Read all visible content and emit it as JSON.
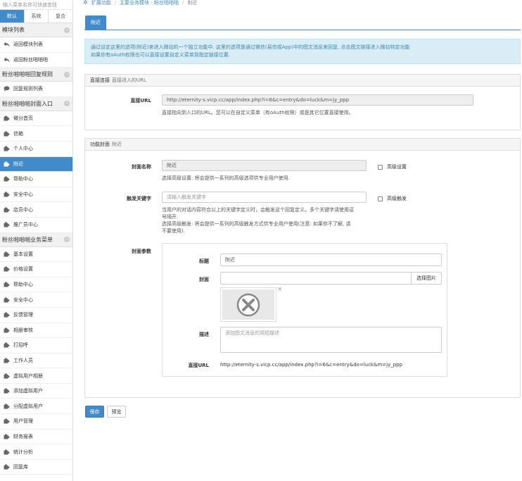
{
  "sidebar": {
    "search_placeholder": "输入菜单名称可快速查找",
    "tabs": [
      "默认",
      "系统",
      "复合"
    ],
    "sections": [
      {
        "title": "模块列表",
        "items": [
          {
            "label": "返回模块列表",
            "icon": "reply-icon"
          },
          {
            "label": "返回粉丝啪啪啪",
            "icon": "reply-icon"
          }
        ]
      },
      {
        "title": "粉丝啪啪啪回复规则",
        "items": [
          {
            "label": "回复规则列表",
            "icon": "comment-icon"
          }
        ]
      },
      {
        "title": "粉丝啪啪啪封面入口",
        "items": [
          {
            "label": "微分首页",
            "icon": "puzzle-icon"
          },
          {
            "label": "信箱",
            "icon": "puzzle-icon"
          },
          {
            "label": "个人中心",
            "icon": "puzzle-icon"
          },
          {
            "label": "附近",
            "icon": "puzzle-icon",
            "active": true
          },
          {
            "label": "帮助中心",
            "icon": "puzzle-icon"
          },
          {
            "label": "安全中心",
            "icon": "puzzle-icon"
          },
          {
            "label": "店员中心",
            "icon": "puzzle-icon"
          },
          {
            "label": "推广员中心",
            "icon": "puzzle-icon"
          }
        ]
      },
      {
        "title": "粉丝啪啪啪业务菜单",
        "items": [
          {
            "label": "基本设置",
            "icon": "puzzle-icon"
          },
          {
            "label": "价格设置",
            "icon": "puzzle-icon"
          },
          {
            "label": "帮助中心",
            "icon": "puzzle-icon"
          },
          {
            "label": "安全中心",
            "icon": "puzzle-icon"
          },
          {
            "label": "反馈管理",
            "icon": "puzzle-icon"
          },
          {
            "label": "相册审核",
            "icon": "puzzle-icon"
          },
          {
            "label": "打招呼",
            "icon": "puzzle-icon"
          },
          {
            "label": "工作人员",
            "icon": "puzzle-icon"
          },
          {
            "label": "虚拟用户相册",
            "icon": "puzzle-icon"
          },
          {
            "label": "添加虚拟用户",
            "icon": "puzzle-icon"
          },
          {
            "label": "分配虚拟用户",
            "icon": "puzzle-icon"
          },
          {
            "label": "用户管理",
            "icon": "puzzle-icon"
          },
          {
            "label": "财务报表",
            "icon": "puzzle-icon"
          },
          {
            "label": "统计分析",
            "icon": "puzzle-icon"
          },
          {
            "label": "回复库",
            "icon": "puzzle-icon"
          }
        ]
      }
    ]
  },
  "breadcrumb": [
    "扩展功能",
    "主要业务模块 - 粉丝啪啪啪",
    "附近"
  ],
  "page_tab": "附近",
  "info": {
    "line1": "通过设定这里的选项(附近)来进入微站的一个独立功能中. 这里的选项是通过微信(易信或App)中的图文消息来回复, 点击图文链接进入微站特定功能",
    "line2": "如果你有oAuth权限也可以直接设置自定义菜单到指定链接位置."
  },
  "direct": {
    "title": "直接连接",
    "subtitle": "直接进入的URL",
    "label": "直接URL",
    "value": "http://eternity-s.vicp.cc/app/index.php?i=6&c=entry&do=luck&m=jy_ppp",
    "help": "直接指向到入口的URL。您可以在自定义菜单（有oAuth权限）或是其它位置直接使用。"
  },
  "cover": {
    "title": "功能封面",
    "subtitle": "附近",
    "name_label": "封面名称",
    "name_value": "附近",
    "name_help": "选择高级设置: 将会提供一系列的高级选项供专业用户使用.",
    "adv_settings": "高级设置",
    "kw_label": "触发关键字",
    "kw_placeholder": "请输入触发关键字",
    "adv_trigger": "高级触发",
    "kw_help1": "当用户的对话内容符合以上的关键字定义时，会触发这个回复定义。多个关键字请使用逗",
    "kw_help2": "号隔开.",
    "kw_help3": "选择高级触发: 将会提供一系列的高级触发方式供专业用户使用(注意: 如果你不了解, 请",
    "kw_help4": "不要使用).",
    "params_label": "封面参数",
    "params": {
      "title_label": "标题",
      "title_value": "附近",
      "image_label": "封面",
      "image_value": "",
      "choose_image": "选择图片",
      "remove": "×",
      "desc_label": "描述",
      "desc_placeholder": "添加图文消息的简短描述",
      "url_label": "直接URL",
      "url_value": "http://eternity-s.vicp.cc/app/index.php?i=6&c=entry&do=luck&m=jy_ppp"
    }
  },
  "actions": {
    "save": "保存",
    "preview": "预览"
  },
  "colors": {
    "primary": "#428bca",
    "info_bg": "#d9edf7",
    "info_text": "#3a87ad"
  }
}
